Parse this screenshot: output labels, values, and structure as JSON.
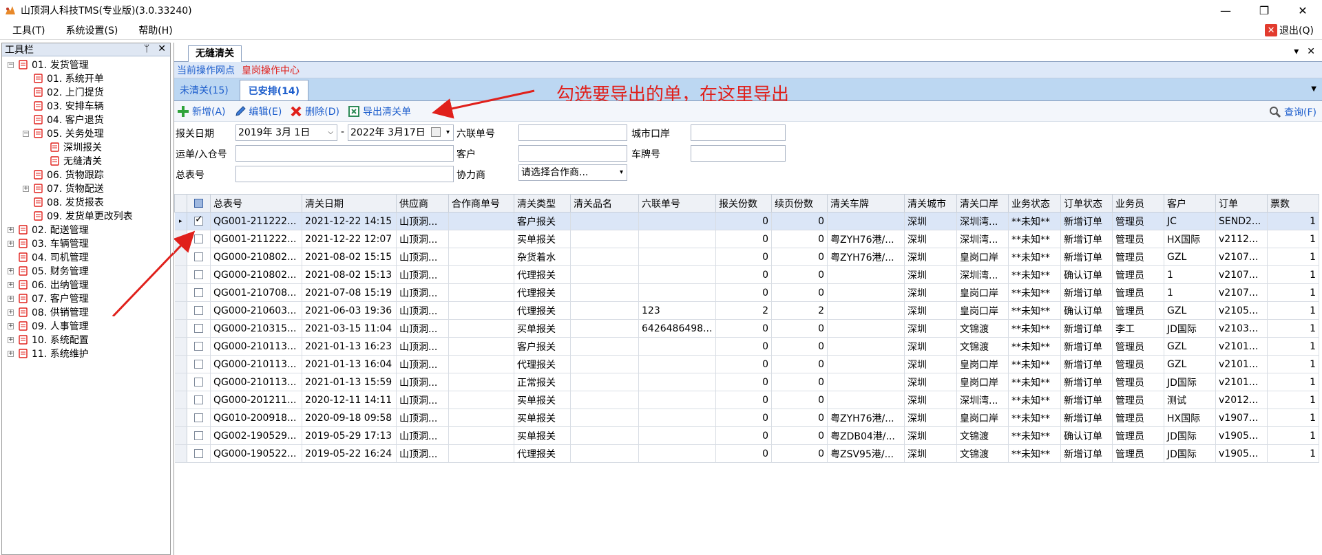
{
  "window": {
    "title": "山顶洞人科技TMS(专业版)(3.0.33240)",
    "minimize": "—",
    "restore": "❐",
    "close": "✕"
  },
  "menu": {
    "items": [
      "工具(T)",
      "系统设置(S)",
      "帮助(H)"
    ],
    "exit_label": "退出(Q)"
  },
  "toolbox": {
    "title": "工具栏",
    "pin": "ᛘ",
    "close": "✕",
    "tree": [
      {
        "label": "01. 发货管理",
        "level": 0,
        "expander": "−"
      },
      {
        "label": "01. 系统开单",
        "level": 1
      },
      {
        "label": "02. 上门提货",
        "level": 1
      },
      {
        "label": "03. 安排车辆",
        "level": 1
      },
      {
        "label": "04. 客户退货",
        "level": 1
      },
      {
        "label": "05. 关务处理",
        "level": 1,
        "expander": "−"
      },
      {
        "label": "深圳报关",
        "level": 2
      },
      {
        "label": "无缝清关",
        "level": 2
      },
      {
        "label": "06. 货物跟踪",
        "level": 1
      },
      {
        "label": "07. 货物配送",
        "level": 1,
        "expander": "+"
      },
      {
        "label": "08. 发货报表",
        "level": 1
      },
      {
        "label": "09. 发货单更改列表",
        "level": 1
      },
      {
        "label": "02. 配送管理",
        "level": 0,
        "expander": "+"
      },
      {
        "label": "03. 车辆管理",
        "level": 0,
        "expander": "+"
      },
      {
        "label": "04. 司机管理",
        "level": 0
      },
      {
        "label": "05. 财务管理",
        "level": 0,
        "expander": "+"
      },
      {
        "label": "06. 出纳管理",
        "level": 0,
        "expander": "+"
      },
      {
        "label": "07. 客户管理",
        "level": 0,
        "expander": "+"
      },
      {
        "label": "08. 供销管理",
        "level": 0,
        "expander": "+"
      },
      {
        "label": "09. 人事管理",
        "level": 0,
        "expander": "+"
      },
      {
        "label": "10. 系统配置",
        "level": 0,
        "expander": "+"
      },
      {
        "label": "11. 系统维护",
        "level": 0,
        "expander": "+"
      }
    ]
  },
  "doc_tab": {
    "label": "无缝清关",
    "dropdown": "▾",
    "close": "✕"
  },
  "opbar": {
    "label": "当前操作网点",
    "value": "皇岗操作中心"
  },
  "subtabs": {
    "pending": "未清关(15)",
    "arranged": "已安排(14)",
    "more": "▼"
  },
  "annotation": {
    "text": "勾选要导出的单，在这里导出"
  },
  "toolbar": {
    "add": "新增(A)",
    "edit": "编辑(E)",
    "delete": "删除(D)",
    "export": "导出清关单",
    "query": "查询(F)"
  },
  "filters": {
    "date_label": "报关日期",
    "date_from": "2019年 3月 1日",
    "date_sep": "-",
    "date_to": "2022年 3月17日",
    "six_label": "六联单号",
    "port_label": "城市口岸",
    "waybill_label": "运单/入仓号",
    "customer_label": "客户",
    "plate_label": "车牌号",
    "master_label": "总表号",
    "partner_label": "协力商",
    "partner_placeholder": "请选择合作商..."
  },
  "grid": {
    "columns": [
      "总表号",
      "清关日期",
      "供应商",
      "合作商单号",
      "清关类型",
      "清关品名",
      "六联单号",
      "报关份数",
      "续页份数",
      "清关车牌",
      "清关城市",
      "清关口岸",
      "业务状态",
      "订单状态",
      "业务员",
      "客户",
      "订单",
      "票数"
    ],
    "rows": [
      {
        "checked": true,
        "c": [
          "QG001-211222...",
          "2021-12-22 14:15",
          "山顶洞...",
          "",
          "客户报关",
          "",
          "",
          "0",
          "0",
          "",
          "深圳",
          "深圳湾...",
          "**未知**",
          "新增订单",
          "管理员",
          "JC",
          "SEND2...",
          "1"
        ]
      },
      {
        "checked": false,
        "c": [
          "QG001-211222...",
          "2021-12-22 12:07",
          "山顶洞...",
          "",
          "买单报关",
          "",
          "",
          "0",
          "0",
          "粤ZYH76港/...",
          "深圳",
          "深圳湾...",
          "**未知**",
          "新增订单",
          "管理员",
          "HX国际",
          "v2112...",
          "1"
        ]
      },
      {
        "checked": false,
        "c": [
          "QG000-210802...",
          "2021-08-02 15:15",
          "山顶洞...",
          "",
          "杂货着水",
          "",
          "",
          "0",
          "0",
          "粤ZYH76港/...",
          "深圳",
          "皇岗口岸",
          "**未知**",
          "新增订单",
          "管理员",
          "GZL",
          "v2107...",
          "1"
        ]
      },
      {
        "checked": false,
        "c": [
          "QG000-210802...",
          "2021-08-02 15:13",
          "山顶洞...",
          "",
          "代理报关",
          "",
          "",
          "0",
          "0",
          "",
          "深圳",
          "深圳湾...",
          "**未知**",
          "确认订单",
          "管理员",
          "1",
          "v2107...",
          "1"
        ]
      },
      {
        "checked": false,
        "c": [
          "QG001-210708...",
          "2021-07-08 15:19",
          "山顶洞...",
          "",
          "代理报关",
          "",
          "",
          "0",
          "0",
          "",
          "深圳",
          "皇岗口岸",
          "**未知**",
          "新增订单",
          "管理员",
          "1",
          "v2107...",
          "1"
        ]
      },
      {
        "checked": false,
        "c": [
          "QG000-210603...",
          "2021-06-03 19:36",
          "山顶洞...",
          "",
          "代理报关",
          "",
          "123",
          "2",
          "2",
          "",
          "深圳",
          "皇岗口岸",
          "**未知**",
          "确认订单",
          "管理员",
          "GZL",
          "v2105...",
          "1"
        ]
      },
      {
        "checked": false,
        "c": [
          "QG000-210315...",
          "2021-03-15 11:04",
          "山顶洞...",
          "",
          "买单报关",
          "",
          "6426486498...",
          "0",
          "0",
          "",
          "深圳",
          "文锦渡",
          "**未知**",
          "新增订单",
          "李工",
          "JD国际",
          "v2103...",
          "1"
        ]
      },
      {
        "checked": false,
        "c": [
          "QG000-210113...",
          "2021-01-13 16:23",
          "山顶洞...",
          "",
          "客户报关",
          "",
          "",
          "0",
          "0",
          "",
          "深圳",
          "文锦渡",
          "**未知**",
          "新增订单",
          "管理员",
          "GZL",
          "v2101...",
          "1"
        ]
      },
      {
        "checked": false,
        "c": [
          "QG000-210113...",
          "2021-01-13 16:04",
          "山顶洞...",
          "",
          "代理报关",
          "",
          "",
          "0",
          "0",
          "",
          "深圳",
          "皇岗口岸",
          "**未知**",
          "新增订单",
          "管理员",
          "GZL",
          "v2101...",
          "1"
        ]
      },
      {
        "checked": false,
        "c": [
          "QG000-210113...",
          "2021-01-13 15:59",
          "山顶洞...",
          "",
          "正常报关",
          "",
          "",
          "0",
          "0",
          "",
          "深圳",
          "皇岗口岸",
          "**未知**",
          "新增订单",
          "管理员",
          "JD国际",
          "v2101...",
          "1"
        ]
      },
      {
        "checked": false,
        "c": [
          "QG000-201211...",
          "2020-12-11 14:11",
          "山顶洞...",
          "",
          "买单报关",
          "",
          "",
          "0",
          "0",
          "",
          "深圳",
          "深圳湾...",
          "**未知**",
          "新增订单",
          "管理员",
          "测试",
          "v2012...",
          "1"
        ]
      },
      {
        "checked": false,
        "c": [
          "QG010-200918...",
          "2020-09-18 09:58",
          "山顶洞...",
          "",
          "买单报关",
          "",
          "",
          "0",
          "0",
          "粤ZYH76港/...",
          "深圳",
          "皇岗口岸",
          "**未知**",
          "新增订单",
          "管理员",
          "HX国际",
          "v1907...",
          "1"
        ]
      },
      {
        "checked": false,
        "c": [
          "QG002-190529...",
          "2019-05-29 17:13",
          "山顶洞...",
          "",
          "买单报关",
          "",
          "",
          "0",
          "0",
          "粤ZDB04港/...",
          "深圳",
          "文锦渡",
          "**未知**",
          "确认订单",
          "管理员",
          "JD国际",
          "v1905...",
          "1"
        ]
      },
      {
        "checked": false,
        "c": [
          "QG000-190522...",
          "2019-05-22 16:24",
          "山顶洞...",
          "",
          "代理报关",
          "",
          "",
          "0",
          "0",
          "粤ZSV95港/...",
          "深圳",
          "文锦渡",
          "**未知**",
          "新增订单",
          "管理员",
          "JD国际",
          "v1905...",
          "1"
        ]
      }
    ]
  },
  "colors": {
    "accent_blue": "#1c5dcc",
    "red": "#e0201b",
    "tab_band": "#bcd7f2"
  }
}
